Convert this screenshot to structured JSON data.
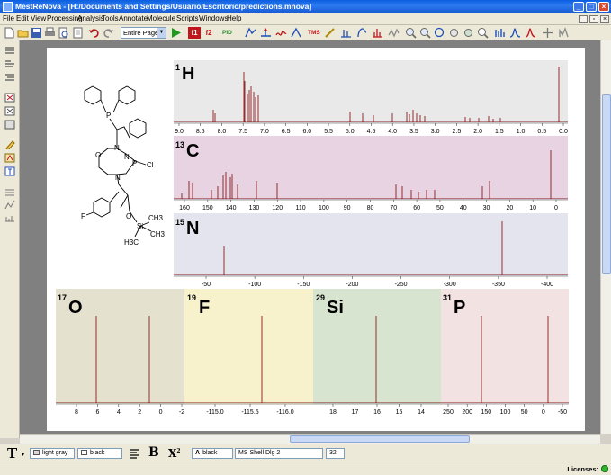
{
  "window": {
    "title": "MestReNova - [H:/Documents and Settings/Usuario/Escritorio/predictions.mnova]"
  },
  "menu": [
    "File",
    "Edit",
    "View",
    "Processing",
    "Analysis",
    "Tools",
    "Annotate",
    "Molecule",
    "Scripts",
    "Windows",
    "Help"
  ],
  "toolbar": {
    "page_select": "Entire Page",
    "btn_f1": "f1",
    "btn_f2": "f2",
    "btn_pid": "PID",
    "btn_tms": "TMS",
    "colors": {
      "red": "#c0161c",
      "blue": "#1f4fb8",
      "green": "#2b8a2b"
    }
  },
  "molecule": {
    "atoms": [
      "P",
      "N",
      "N",
      "P",
      "Cl",
      "O",
      "N",
      "F",
      "O",
      "Si",
      "CH3",
      "CH3",
      "H3C"
    ]
  },
  "spectra": {
    "h1": {
      "mass": "1",
      "element": "H",
      "bg": "#e9e9e9",
      "ticks": [
        "9.0",
        "8.5",
        "8.0",
        "7.5",
        "7.0",
        "6.5",
        "6.0",
        "5.5",
        "5.0",
        "4.5",
        "4.0",
        "3.5",
        "3.0",
        "2.5",
        "2.0",
        "1.5",
        "1.0",
        "0.5",
        "0.0"
      ]
    },
    "c13": {
      "mass": "13",
      "element": "C",
      "bg": "#e7d3e2",
      "ticks": [
        "160",
        "150",
        "140",
        "130",
        "120",
        "110",
        "100",
        "90",
        "80",
        "70",
        "60",
        "50",
        "40",
        "30",
        "20",
        "10",
        "0"
      ]
    },
    "n15": {
      "mass": "15",
      "element": "N",
      "bg": "#e4e4ef",
      "ticks": [
        "-50",
        "-100",
        "-150",
        "-200",
        "-250",
        "-300",
        "-350",
        "-400"
      ]
    },
    "o17": {
      "mass": "17",
      "element": "O",
      "bg": "#e4e2cf",
      "ticks": [
        "8",
        "6",
        "4",
        "2",
        "0",
        "-2"
      ]
    },
    "f19": {
      "mass": "19",
      "element": "F",
      "bg": "#f7f2cc",
      "ticks": [
        "-115.0",
        "-115.5",
        "-116.0"
      ]
    },
    "si29": {
      "mass": "29",
      "element": "Si",
      "bg": "#d7e5d0",
      "ticks": [
        "18",
        "17",
        "16",
        "15",
        "14"
      ]
    },
    "p31": {
      "mass": "31",
      "element": "P",
      "bg": "#f2e2e2",
      "ticks": [
        "250",
        "200",
        "150",
        "100",
        "50",
        "0",
        "-50"
      ]
    },
    "peak_color": "#8a1a1a"
  },
  "textbar": {
    "bg_color_label": "light gray",
    "fg_color_label": "black",
    "font_color_label": "black",
    "font_name": "MS Shell Dlg 2",
    "font_size": "32",
    "btn_text": "T",
    "btn_bold": "B",
    "btn_super": "X"
  },
  "status": {
    "licenses": "Licenses:"
  }
}
